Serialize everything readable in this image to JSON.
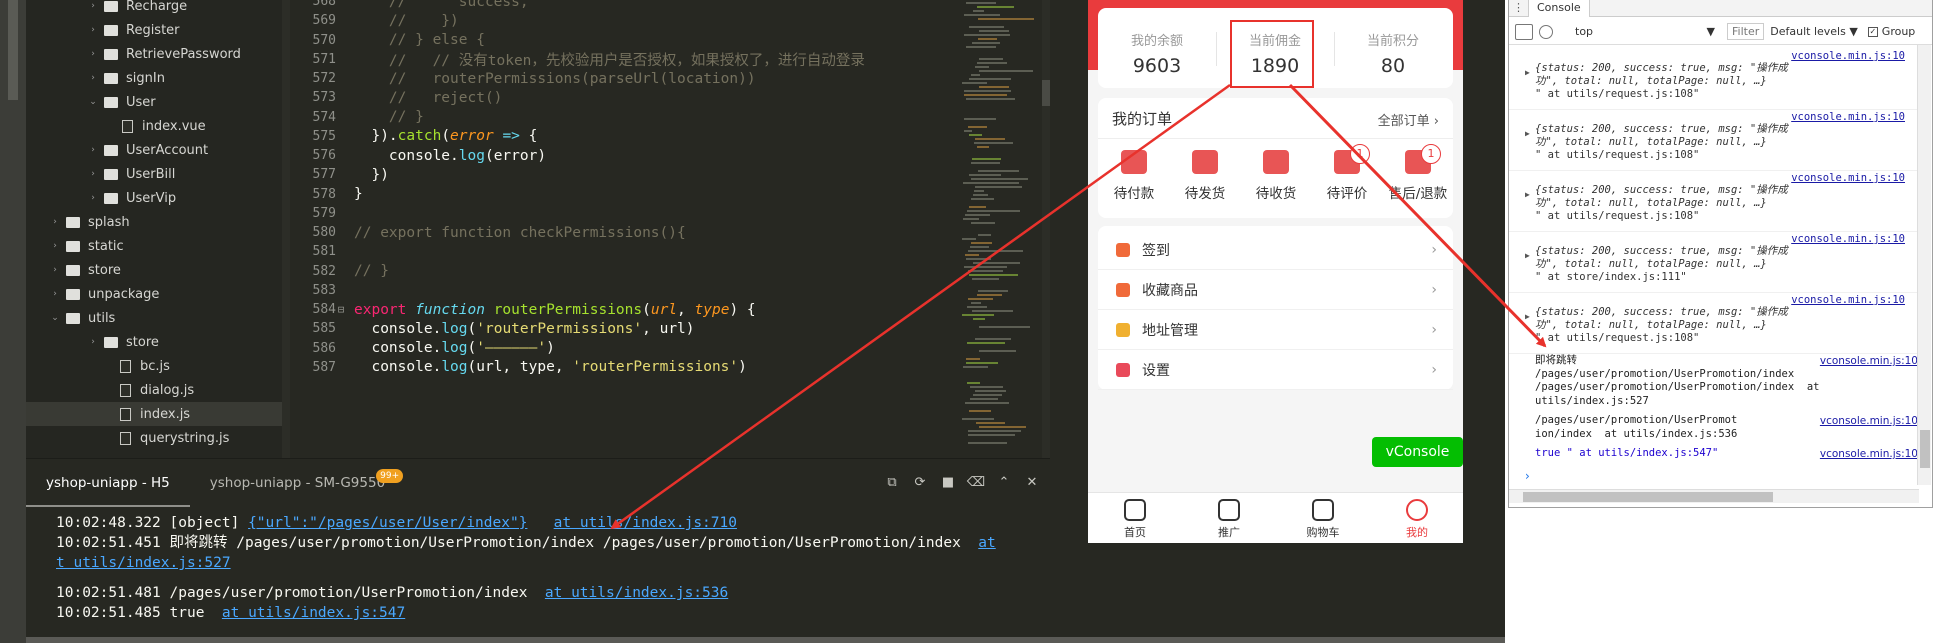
{
  "tree": {
    "items": [
      {
        "label": "Recharge",
        "kind": "folder",
        "open": false
      },
      {
        "label": "Register",
        "kind": "folder",
        "open": false
      },
      {
        "label": "RetrievePassword",
        "kind": "folder",
        "open": false
      },
      {
        "label": "signIn",
        "kind": "folder",
        "open": false
      },
      {
        "label": "User",
        "kind": "folder",
        "open": true
      },
      {
        "label": "index.vue",
        "kind": "file"
      },
      {
        "label": "UserAccount",
        "kind": "folder",
        "open": false
      },
      {
        "label": "UserBill",
        "kind": "folder",
        "open": false
      },
      {
        "label": "UserVip",
        "kind": "folder",
        "open": false
      },
      {
        "label": "splash",
        "kind": "folder",
        "open": false
      },
      {
        "label": "static",
        "kind": "folder",
        "open": false
      },
      {
        "label": "store",
        "kind": "folder",
        "open": false
      },
      {
        "label": "unpackage",
        "kind": "folder",
        "open": false
      },
      {
        "label": "utils",
        "kind": "folder",
        "open": true
      },
      {
        "label": "store",
        "kind": "folder",
        "open": false
      },
      {
        "label": "bc.js",
        "kind": "file"
      },
      {
        "label": "dialog.js",
        "kind": "file"
      },
      {
        "label": "index.js",
        "kind": "file",
        "selected": true
      },
      {
        "label": "querystring.js",
        "kind": "file"
      }
    ]
  },
  "editor": {
    "lines": [
      {
        "n": "568",
        "code": "    //      success,"
      },
      {
        "n": "569",
        "code": "    //    })"
      },
      {
        "n": "570",
        "code": "    // } else {"
      },
      {
        "n": "571",
        "code": "    //   // 没有token，先校验用户是否授权，如果授权了，进行自动登录"
      },
      {
        "n": "572",
        "code": "    //   routerPermissions(parseUrl(location))"
      },
      {
        "n": "573",
        "code": "    //   reject()"
      },
      {
        "n": "574",
        "code": "    // }"
      },
      {
        "n": "575",
        "code": "  }).catch(error => {"
      },
      {
        "n": "576",
        "code": "    console.log(error)"
      },
      {
        "n": "577",
        "code": "  })"
      },
      {
        "n": "578",
        "code": "}"
      },
      {
        "n": "579",
        "code": ""
      },
      {
        "n": "580",
        "code": "// export function checkPermissions(){"
      },
      {
        "n": "581",
        "code": ""
      },
      {
        "n": "582",
        "code": "// }"
      },
      {
        "n": "583",
        "code": ""
      },
      {
        "n": "584",
        "code": "export function routerPermissions(url, type) {"
      },
      {
        "n": "585",
        "code": "  console.log('routerPermissions', url)"
      },
      {
        "n": "586",
        "code": "  console.log('——————')"
      },
      {
        "n": "587",
        "code": "  console.log(url, type, 'routerPermissions')"
      }
    ]
  },
  "console": {
    "tab_active": "yshop-uniapp - H5",
    "tab_inactive": "yshop-uniapp - SM-G9550",
    "tab_badge": "99+",
    "logs": [
      {
        "time": "10:02:48.322",
        "text": "[object] ",
        "link1": "{\"url\":\"/pages/user/User/index\"}",
        "gap": "   ",
        "link2": "at utils/index.js:710"
      },
      {
        "time": "10:02:51.451",
        "text": "即将跳转 /pages/user/promotion/UserPromotion/index /pages/user/promotion/UserPromotion/index  ",
        "link2": "at"
      },
      {
        "time": "",
        "text": "",
        "link2": "t utils/index.js:527"
      },
      {
        "time": "10:02:51.481",
        "text": "/pages/user/promotion/UserPromotion/index  ",
        "link2": "at utils/index.js:536"
      },
      {
        "time": "10:02:51.485",
        "text": "true  ",
        "link2": "at utils/index.js:547"
      }
    ]
  },
  "phone": {
    "stats": [
      {
        "label": "我的余额",
        "value": "9603"
      },
      {
        "label": "当前佣金",
        "value": "1890"
      },
      {
        "label": "当前积分",
        "value": "80"
      }
    ],
    "orders_title": "我的订单",
    "orders_more": "全部订单 ›",
    "order_items": [
      {
        "label": "待付款"
      },
      {
        "label": "待发货"
      },
      {
        "label": "待收货"
      },
      {
        "label": "待评价",
        "badge": "1"
      },
      {
        "label": "售后/退款",
        "badge": "1"
      }
    ],
    "menu": [
      {
        "label": "签到"
      },
      {
        "label": "收藏商品"
      },
      {
        "label": "地址管理"
      },
      {
        "label": "设置"
      }
    ],
    "chevron": "›",
    "vconsole": "vConsole",
    "tabbar": [
      {
        "label": "首页"
      },
      {
        "label": "推广"
      },
      {
        "label": "购物车"
      },
      {
        "label": "我的",
        "active": true
      }
    ]
  },
  "devtools": {
    "tab": "Console",
    "context": "top",
    "filter": "Filter",
    "levels": "Default levels ▼",
    "group": "Group",
    "src": "vconsole.min.js:10",
    "obj_line1": "{status: 200, success: true, msg: \"操作成",
    "obj_line2": "功\", total: null, totalPage: null, …}",
    "messages": [
      {
        "at": "\" at utils/request.js:108\""
      },
      {
        "at": "\" at utils/request.js:108\""
      },
      {
        "at": "\" at utils/request.js:108\""
      },
      {
        "at": "\" at store/index.js:111\""
      },
      {
        "at": "\" at utils/request.js:108\""
      }
    ],
    "plain1": "即将跳转\n/pages/user/promotion/UserPromotion/index\n/pages/user/promotion/UserPromotion/index  at\nutils/index.js:527",
    "plain2": "/pages/user/promotion/UserPromot\nion/index  at utils/index.js:536",
    "plain3": "true \" at utils/index.js:547\"",
    "prompt": "›"
  }
}
